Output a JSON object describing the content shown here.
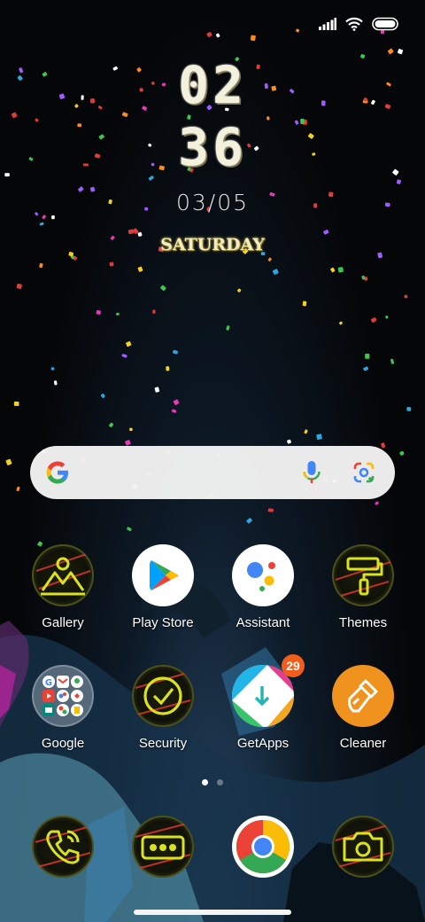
{
  "status_bar": {
    "signal": "signal-icon",
    "wifi": "wifi-icon",
    "battery": "battery-icon"
  },
  "clock": {
    "hour": "02",
    "minute": "36",
    "date": "03/05",
    "day": "SATURDAY"
  },
  "search": {
    "logo": "google-g-icon",
    "voice": "mic-icon",
    "lens": "google-lens-icon"
  },
  "apps_row1": [
    {
      "label": "Gallery",
      "icon": "gallery-icon"
    },
    {
      "label": "Play Store",
      "icon": "play-store-icon"
    },
    {
      "label": "Assistant",
      "icon": "assistant-icon"
    },
    {
      "label": "Themes",
      "icon": "themes-icon"
    }
  ],
  "apps_row2": [
    {
      "label": "Google",
      "icon": "google-folder-icon"
    },
    {
      "label": "Security",
      "icon": "security-icon"
    },
    {
      "label": "GetApps",
      "icon": "getapps-icon",
      "badge": "29"
    },
    {
      "label": "Cleaner",
      "icon": "cleaner-icon"
    }
  ],
  "page_indicator": {
    "pages": 2,
    "current": 1
  },
  "dock": [
    {
      "icon": "phone-icon"
    },
    {
      "icon": "messages-icon"
    },
    {
      "icon": "chrome-icon"
    },
    {
      "icon": "camera-icon"
    }
  ],
  "colors": {
    "badge": "#f25d1c",
    "neon_yellow": "#d9e21a",
    "cleaner_orange": "#f0931e"
  }
}
